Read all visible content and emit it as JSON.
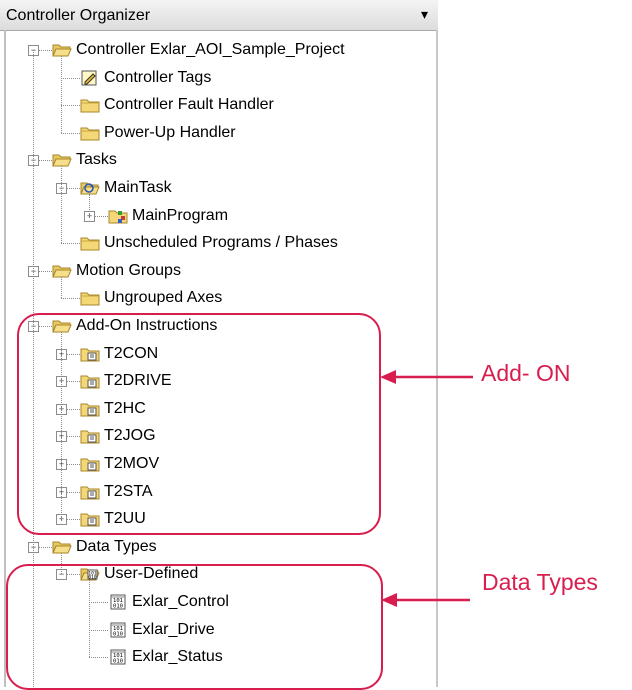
{
  "panel": {
    "title": "Controller Organizer",
    "pin_glyph": "▾"
  },
  "tree": [
    {
      "label": "Controller Exlar_AOI_Sample_Project",
      "icon": "folder-open-icon",
      "level": 0,
      "expander": "minus"
    },
    {
      "label": "Controller Tags",
      "icon": "tags-icon",
      "level": 1
    },
    {
      "label": "Controller Fault Handler",
      "icon": "folder-icon",
      "level": 1
    },
    {
      "label": "Power-Up Handler",
      "icon": "folder-icon",
      "level": 1
    },
    {
      "label": "Tasks",
      "icon": "folder-open-icon",
      "level": 0,
      "expander": "minus"
    },
    {
      "label": "MainTask",
      "icon": "task-icon",
      "level": 1,
      "expander": "minus"
    },
    {
      "label": "MainProgram",
      "icon": "program-icon",
      "level": 2,
      "expander": "plus"
    },
    {
      "label": "Unscheduled Programs / Phases",
      "icon": "folder-icon",
      "level": 1
    },
    {
      "label": "Motion Groups",
      "icon": "folder-open-icon",
      "level": 0,
      "expander": "minus"
    },
    {
      "label": "Ungrouped Axes",
      "icon": "folder-icon",
      "level": 1
    },
    {
      "label": "Add-On Instructions",
      "icon": "folder-open-icon",
      "level": 0,
      "expander": "minus"
    },
    {
      "label": "T2CON",
      "icon": "aoi-icon",
      "level": 1,
      "expander": "plus"
    },
    {
      "label": "T2DRIVE",
      "icon": "aoi-icon",
      "level": 1,
      "expander": "plus"
    },
    {
      "label": "T2HC",
      "icon": "aoi-icon",
      "level": 1,
      "expander": "plus"
    },
    {
      "label": "T2JOG",
      "icon": "aoi-icon",
      "level": 1,
      "expander": "plus"
    },
    {
      "label": "T2MOV",
      "icon": "aoi-icon",
      "level": 1,
      "expander": "plus"
    },
    {
      "label": "T2STA",
      "icon": "aoi-icon",
      "level": 1,
      "expander": "plus"
    },
    {
      "label": "T2UU",
      "icon": "aoi-icon",
      "level": 1,
      "expander": "plus"
    },
    {
      "label": "Data Types",
      "icon": "folder-open-icon",
      "level": 0,
      "expander": "minus"
    },
    {
      "label": "User-Defined",
      "icon": "udt-folder-icon",
      "level": 1,
      "expander": "minus"
    },
    {
      "label": "Exlar_Control",
      "icon": "datatype-icon",
      "level": 2
    },
    {
      "label": "Exlar_Drive",
      "icon": "datatype-icon",
      "level": 2
    },
    {
      "label": "Exlar_Status",
      "icon": "datatype-icon",
      "level": 2
    }
  ],
  "annotations": {
    "addon": "Add- ON",
    "datatypes": "Data Types",
    "color": "#d81e4f"
  }
}
